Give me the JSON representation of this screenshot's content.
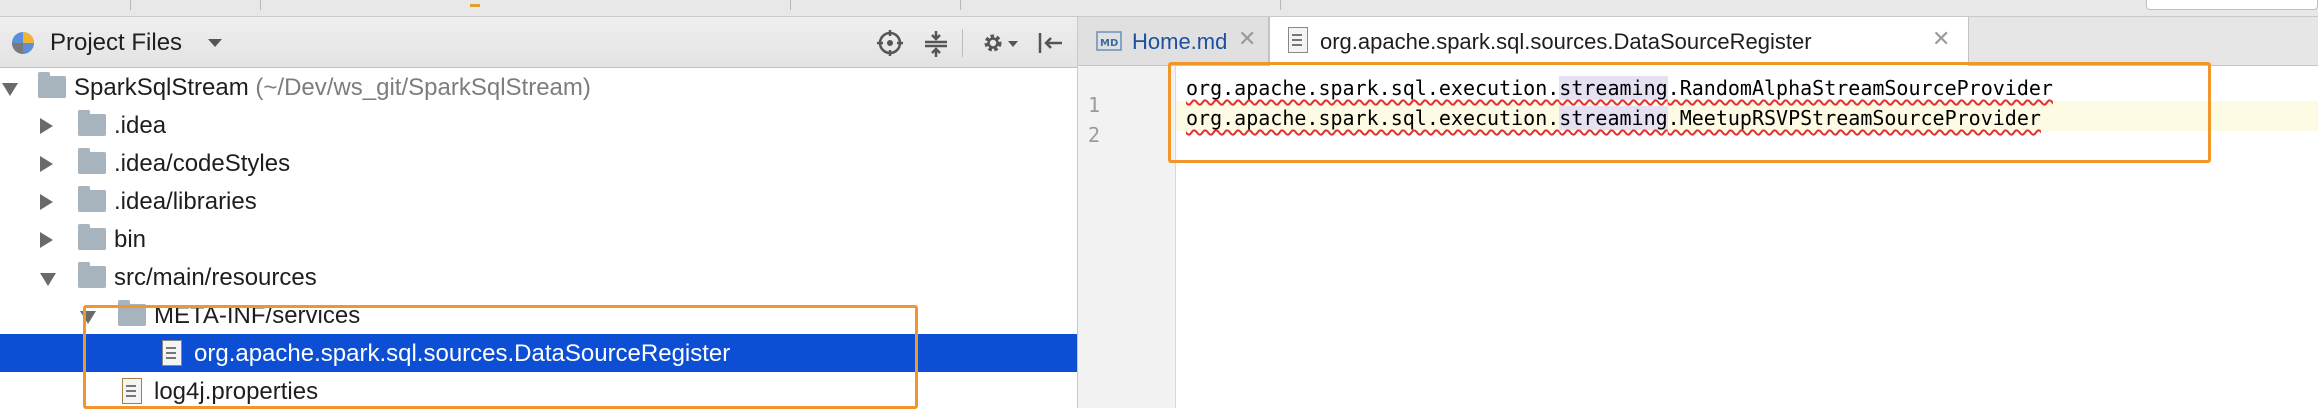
{
  "project_panel": {
    "title": "Project Files",
    "icons": [
      "target-icon",
      "collapse-icon",
      "gear-icon",
      "hide-panel-icon"
    ]
  },
  "tree": {
    "root": {
      "name": "SparkSqlStream",
      "path": "(~/Dev/ws_git/SparkSqlStream)"
    },
    "items": [
      {
        "label": ".idea"
      },
      {
        "label": ".idea/codeStyles"
      },
      {
        "label": ".idea/libraries"
      },
      {
        "label": "bin"
      },
      {
        "label": "src/main/resources"
      },
      {
        "label": "META-INF/services"
      },
      {
        "label": "org.apache.spark.sql.sources.DataSourceRegister"
      },
      {
        "label": "log4j.properties"
      }
    ]
  },
  "editor": {
    "tabs": [
      {
        "label": "Home.md",
        "icon": "markdown-icon",
        "active": false
      },
      {
        "label": "org.apache.spark.sql.sources.DataSourceRegister",
        "icon": "file-icon",
        "active": true
      }
    ],
    "lines": [
      {
        "number": "1",
        "prefix": "org.apache.spark.sql.execution.",
        "kw": "streaming",
        "suffix": ".RandomAlphaStreamSourceProvider"
      },
      {
        "number": "2",
        "prefix": "org.apache.spark.sql.execution.",
        "kw": "streaming",
        "suffix": ".MeetupRSVPStreamSourceProvider"
      }
    ]
  },
  "colors": {
    "highlight_box": "#f0962c",
    "selection": "#0d4fd4"
  }
}
